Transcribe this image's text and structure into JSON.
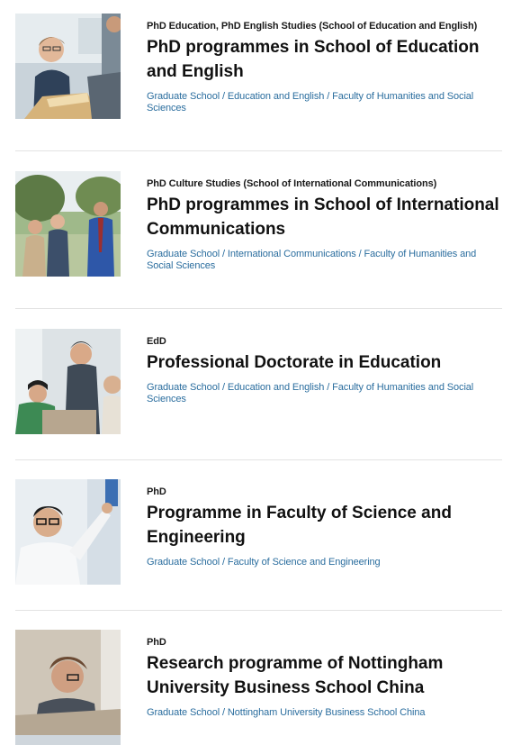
{
  "programmes": [
    {
      "qualification": "PhD Education, PhD English Studies (School of Education and English)",
      "title": "PhD programmes in School of Education and English",
      "meta": "Graduate School / Education and English / Faculty of Humanities and Social Sciences",
      "image": "photo-woman-reading-book"
    },
    {
      "qualification": "PhD Culture Studies (School of International Communications)",
      "title": "PhD programmes in School of International Communications",
      "meta": "Graduate School / International Communications / Faculty of Humanities and Social Sciences",
      "image": "photo-students-outdoors"
    },
    {
      "qualification": "EdD",
      "title": "Professional Doctorate in Education",
      "meta": "Graduate School / Education and English / Faculty of Humanities and Social Sciences",
      "image": "photo-classroom-teacher"
    },
    {
      "qualification": "PhD",
      "title": "Programme in Faculty of Science and Engineering",
      "meta": "Graduate School / Faculty of Science and Engineering",
      "image": "photo-scientist-lab"
    },
    {
      "qualification": "PhD",
      "title": "Research programme of Nottingham University Business School China",
      "meta": "Graduate School / Nottingham University Business School China",
      "image": "photo-researcher-desk"
    }
  ]
}
